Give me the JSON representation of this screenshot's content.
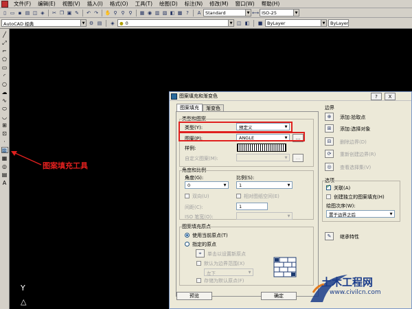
{
  "menu": [
    "文件(F)",
    "编辑(E)",
    "视图(V)",
    "插入(I)",
    "格式(O)",
    "工具(T)",
    "绘图(D)",
    "标注(N)",
    "修改(M)",
    "窗口(W)",
    "帮助(H)"
  ],
  "toolbar": {
    "text_style": "Standard",
    "dim_style": "ISO-25",
    "workspace": "AutoCAD 经典",
    "layer": "0",
    "color": "ByLayer",
    "linetype": "ByLayer"
  },
  "annotation": {
    "label": "图案填充工具",
    "color": "#e0201e"
  },
  "dialog": {
    "title": "图案填充和渐变色",
    "help_btn": "?",
    "close_btn": "X",
    "tabs": [
      "图案填充",
      "渐变色"
    ],
    "type_and_pattern": {
      "group_label": "类型和图案",
      "type_label": "类型(Y):",
      "type_value": "预定义",
      "pattern_label": "图案(P):",
      "pattern_value": "ANGLE",
      "browse_btn": "...",
      "swatch_label": "样例:",
      "custom_label": "自定义图案(M):",
      "custom_btn": "..."
    },
    "angle_scale": {
      "group_label": "角度和比例",
      "angle_label": "角度(G):",
      "angle_value": "0",
      "scale_label": "比例(S):",
      "scale_value": "1",
      "double_label": "双向(U)",
      "relative_label": "相对图纸空间(E)",
      "spacing_label": "间距(C):",
      "spacing_value": "1",
      "iso_label": "ISO 笔宽(O):"
    },
    "origin": {
      "group_label": "图案填充原点",
      "use_current": "使用当前原点(T)",
      "specified": "指定的原点",
      "click_set": "单击以设置新原点",
      "default_extent": "默认为边界范围(X)",
      "position": "左下",
      "store_default": "存储为默认原点(F)"
    },
    "boundary": {
      "group_label": "边界",
      "add_pick": "添加:拾取点",
      "add_select": "添加:选择对象",
      "remove": "删除边界(D)",
      "recreate": "重新创建边界(R)",
      "view_sel": "查看选择集(V)"
    },
    "options": {
      "group_label": "选项",
      "associative": "关联(A)",
      "separate": "创建独立的图案填充(H)",
      "draw_order_label": "绘图次序(W):",
      "draw_order_value": "置于边界之后",
      "inherit": "继承特性"
    },
    "footer": {
      "preview": "预览",
      "ok": "确定"
    }
  },
  "ucs_labels": {
    "y_axis": "Y"
  },
  "watermark": {
    "title": "土木工程网",
    "url": "www.civilcn.com"
  }
}
